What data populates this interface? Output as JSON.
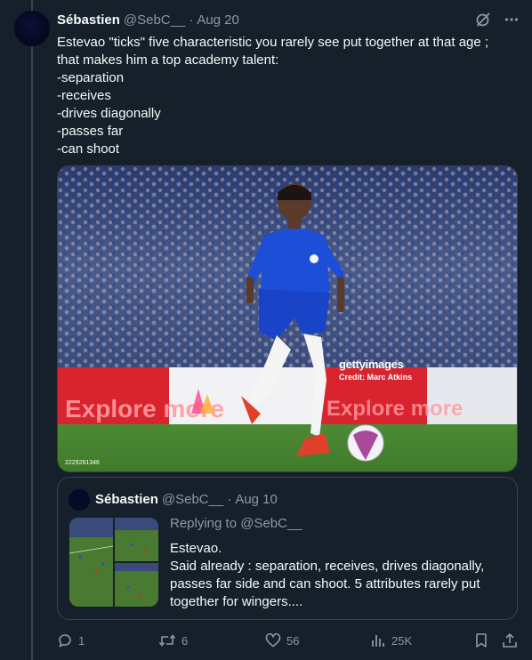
{
  "tweet": {
    "author_name": "Sébastien",
    "author_handle": "@SebC__",
    "separator": "·",
    "date": "Aug 20",
    "text_lines": [
      "Estevao \"ticks\" five characteristic you rarely see put together at that age ;",
      "that makes him a top academy talent:",
      "-separation",
      "-receives",
      "-drives diagonally",
      "-passes far",
      "-can shoot"
    ],
    "media": {
      "watermark": "gettyimages",
      "credit": "Credit: Marc Atkins",
      "image_id": "2229261346"
    }
  },
  "quote": {
    "author_name": "Sébastien",
    "author_handle": "@SebC__",
    "separator": "·",
    "date": "Aug 10",
    "replying_to": "Replying to @SebC__",
    "text_lines": [
      "Estevao.",
      "Said already : separation, receives, drives diagonally,",
      "passes far side and can shoot. 5 attributes rarely put",
      "together for wingers...."
    ]
  },
  "actions": {
    "replies": "1",
    "reposts": "6",
    "likes": "56",
    "views": "25K"
  },
  "icons": {
    "grok": "grok-icon",
    "more": "more-icon",
    "reply": "reply-icon",
    "repost": "repost-icon",
    "like": "heart-icon",
    "views": "views-icon",
    "bookmark": "bookmark-icon",
    "share": "share-icon"
  },
  "colors": {
    "background": "#15202b",
    "text": "#f7f9f9",
    "secondary": "#8b98a5",
    "border": "#38444d"
  }
}
